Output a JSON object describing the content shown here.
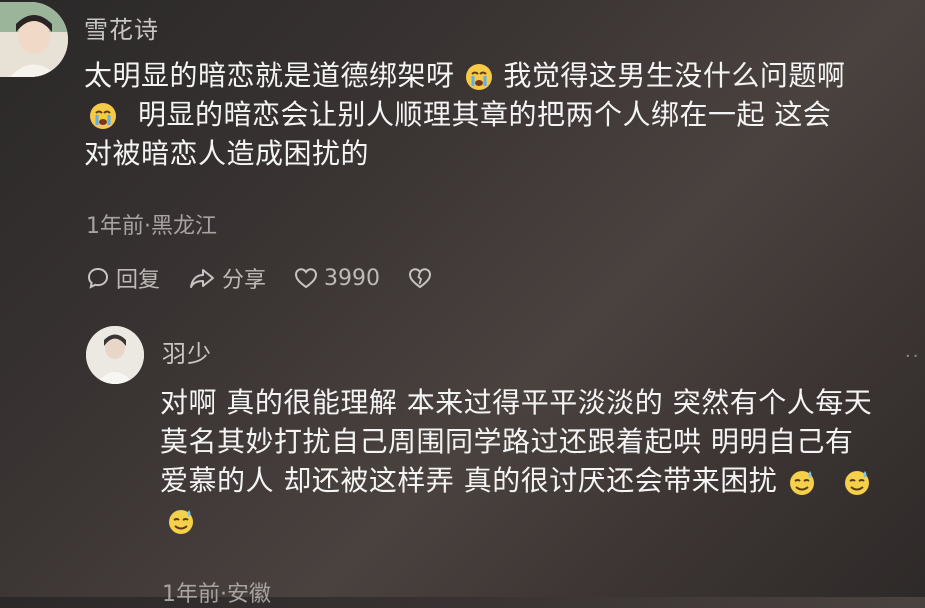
{
  "comment1": {
    "username": "雪花诗",
    "lines": [
      "太明显的暗恋就是道德绑架呀",
      "我觉得这男生没什么问题啊",
      "明显的暗恋会让别人顺理其章的把两个人绑在一起  这会",
      "对被暗恋人造成困扰的"
    ],
    "meta": "1年前·黑龙江",
    "reply_label": "回复",
    "share_label": "分享",
    "like_count": "3990"
  },
  "comment2": {
    "username": "羽少",
    "lines": [
      "对啊 真的很能理解 本来过得平平淡淡的 突然有个人每天",
      "莫名其妙打扰自己周围同学路过还跟着起哄 明明自己有",
      "爱慕的人 却还被这样弄 真的很讨厌还会带来困扰"
    ],
    "meta": "1年前·安徽",
    "more": "··"
  },
  "icons": {
    "crying": "crying-face-icon",
    "sweat": "sweat-smile-icon"
  }
}
